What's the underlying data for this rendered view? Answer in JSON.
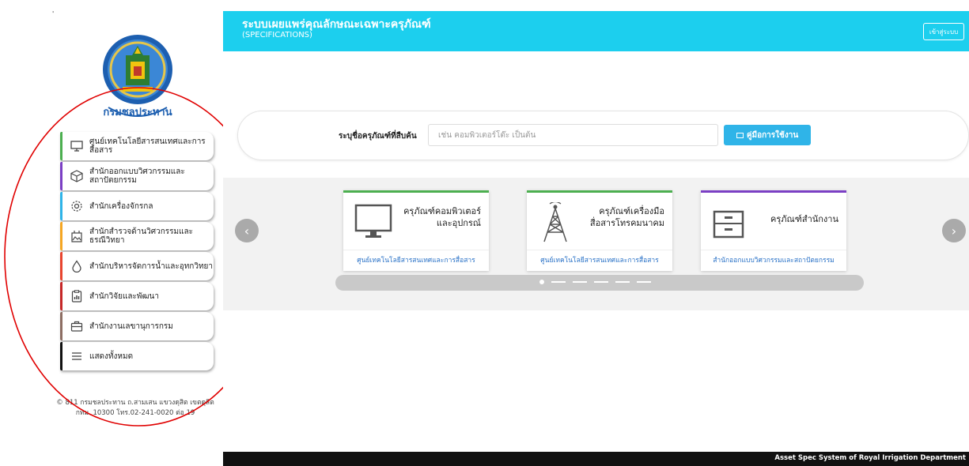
{
  "sidebar": {
    "logo_text": "กรมชลประทาน",
    "menu": [
      {
        "label": "ศูนย์เทคโนโลยีสารสนเทศและการสื่อสาร",
        "icon": "monitor-icon",
        "color": "#4caf50"
      },
      {
        "label": "สำนักออกแบบวิศวกรรมและสถาปัตยกรรม",
        "icon": "box-icon",
        "color": "#7b3fc4"
      },
      {
        "label": "สำนักเครื่องจักรกล",
        "icon": "gear-icon",
        "color": "#2fb4e8"
      },
      {
        "label": "สำนักสำรวจด้านวิศวกรรมและธรณีวิทยา",
        "icon": "landscape-icon",
        "color": "#f5a623"
      },
      {
        "label": "สำนักบริหารจัดการน้ำและอุทกวิทยา",
        "icon": "water-drop-icon",
        "color": "#e8452f"
      },
      {
        "label": "สำนักวิจัยและพัฒนา",
        "icon": "clipboard-chart-icon",
        "color": "#c62828"
      },
      {
        "label": "สำนักงานเลขานุการกรม",
        "icon": "briefcase-icon",
        "color": "#8d6e63"
      },
      {
        "label": "แสดงทั้งหมด",
        "icon": "menu-lines-icon",
        "color": "#111111"
      }
    ],
    "footer_line1": "© 811 กรมชลประทาน ถ.สามเสน แขวงดุสิต เขตดุสิต",
    "footer_line2": "กทม. 10300 โทร.02-241-0020 ต่อ 19"
  },
  "header": {
    "title": "ระบบเผยแพร่คุณลักษณะเฉพาะครุภัณฑ์",
    "subtitle": "(SPECIFICATIONS)",
    "login_label": "เข้าสู่ระบบ"
  },
  "search": {
    "label": "ระบุชื่อครุภัณฑ์ที่สืบค้น",
    "placeholder": "เช่น คอมพิวเตอร์โต๊ะ เป็นต้น",
    "manual_button": "คู่มือการใช้งาน"
  },
  "carousel": {
    "cards": [
      {
        "title": "ครุภัณฑ์คอมพิวเตอร์และอุปกรณ์",
        "subtitle": "ศูนย์เทคโนโลยีสารสนเทศและการสื่อสาร",
        "icon": "computer-monitor-icon",
        "accent": "#4caf50"
      },
      {
        "title": "ครุภัณฑ์เครื่องมือสื่อสารโทรคมนาคม",
        "subtitle": "ศูนย์เทคโนโลยีสารสนเทศและการสื่อสาร",
        "icon": "radio-tower-icon",
        "accent": "#4caf50"
      },
      {
        "title": "ครุภัณฑ์สำนักงาน",
        "subtitle": "สำนักออกแบบวิศวกรรมและสถาปัตยกรรม",
        "icon": "cabinet-icon",
        "accent": "#7b3fc4"
      }
    ]
  },
  "footer": {
    "text": "Asset Spec System of Royal Irrigation Department"
  },
  "colors": {
    "header": "#1ccfee",
    "button": "#2fb4e8",
    "annotation": "#e00000"
  }
}
